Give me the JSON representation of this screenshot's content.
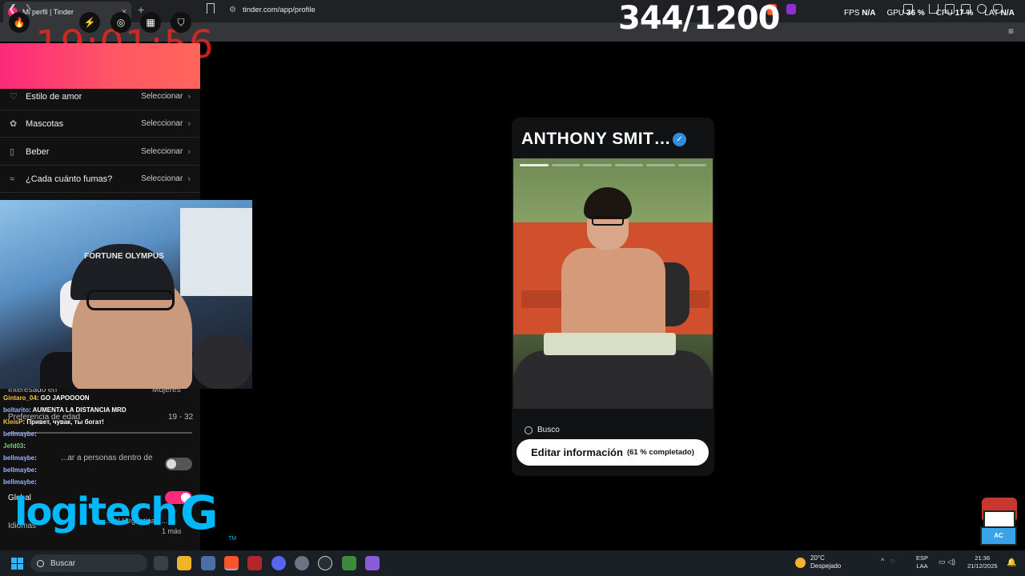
{
  "browser": {
    "tab_title": "Mi perfil | Tinder",
    "tab_close": "×",
    "new_tab": "+",
    "url": "tinder.com/app/profile"
  },
  "overlay": {
    "clock": "19:01:56",
    "counter": "344/1200",
    "stats": [
      {
        "label": "FPS",
        "value": "N/A"
      },
      {
        "label": "GPU",
        "value": "36 %"
      },
      {
        "label": "CPU",
        "value": "17 %"
      },
      {
        "label": "LAT",
        "value": "N/A"
      }
    ]
  },
  "settings": {
    "rows": [
      {
        "label": "Estilo de amor",
        "value": "Seleccionar",
        "icon": "heart-chat-icon"
      },
      {
        "label": "Mascotas",
        "value": "Seleccionar",
        "icon": "paw-icon"
      },
      {
        "label": "Beber",
        "value": "Seleccionar",
        "icon": "bottle-icon"
      },
      {
        "label": "¿Cada cuánto fumas?",
        "value": "Seleccionar",
        "icon": "smoke-icon"
      }
    ],
    "interested_label": "Interesado en",
    "interested_value": "Mujeres",
    "age_label": "Preferencia de edad",
    "age_value": "19 - 32",
    "distance_label": "...ar a personas dentro de",
    "global_label": "Global",
    "lang_label": "Idiomas",
    "lang_value": "...ñol (Argentina), ...",
    "lang_more": "1 más"
  },
  "chat": [
    {
      "user": "Gintaro_04",
      "text": ": GO JAPOOOON"
    },
    {
      "user": "boltarito",
      "text": ": AUMENTA LA DISTANCIA MRD"
    },
    {
      "user": "KleisP",
      "text": ": Привет, чувак, ты богат!"
    },
    {
      "user": "bellmaybe",
      "text": ":"
    },
    {
      "user": "Jefd03",
      "text": ":"
    },
    {
      "user": "bellmaybe",
      "text": ":"
    },
    {
      "user": "bellmaybe",
      "text": ":"
    },
    {
      "user": "bellmaybe",
      "text": ":"
    }
  ],
  "cam": {
    "cap_text": "FORTUNE OLYMPUS"
  },
  "logo": {
    "text": "logitech",
    "g": "G",
    "tm": "TM"
  },
  "profile": {
    "name": "ANTHONY SMIT…",
    "verified_glyph": "✓",
    "busco": "Busco",
    "edit_label": "Editar información",
    "edit_pct": "(61 % completado)",
    "photo_segments": 6,
    "active_segment": 0
  },
  "mascot": {
    "text": "AC"
  },
  "taskbar": {
    "search": "Buscar",
    "temp": "20°C",
    "weather": "Despejado",
    "lang1": "ESP",
    "lang2": "LAA",
    "time": "21:36",
    "date": "21/12/2025"
  },
  "colors": {
    "accent": "#fd297b",
    "verify": "#2f8ee0",
    "logitech": "#00b8fc"
  }
}
